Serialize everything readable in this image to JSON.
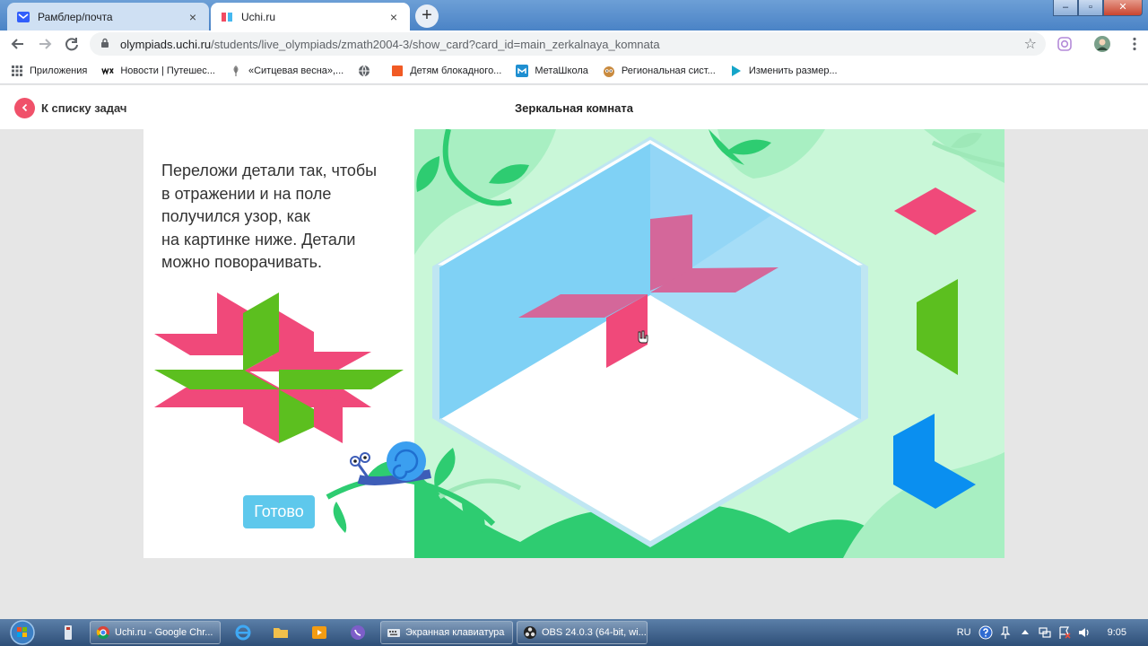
{
  "browser": {
    "tabs": [
      {
        "title": "Рамблер/почта",
        "active": false
      },
      {
        "title": "Uchi.ru",
        "active": true
      }
    ],
    "new_tab_symbol": "+",
    "close_symbol": "×",
    "window_controls": {
      "minimize": "–",
      "maximize": "▫",
      "close": "✕"
    },
    "url": {
      "host": "olympiads.uchi.ru",
      "path": "/students/live_olympiads/zmath2004-3/show_card?card_id=main_zerkalnaya_komnata"
    },
    "bookmarks": [
      {
        "label": "Приложения",
        "icon": "apps-grid-icon"
      },
      {
        "label": "Новости | Путешес...",
        "icon": "wix-icon"
      },
      {
        "label": "«Ситцевая весна»,...",
        "icon": "feather-icon"
      },
      {
        "label": "",
        "icon": "globe-icon"
      },
      {
        "label": "Детям блокадного...",
        "icon": "orange-square-icon"
      },
      {
        "label": "МетаШкола",
        "icon": "metaschool-icon"
      },
      {
        "label": "Региональная сист...",
        "icon": "owl-icon"
      },
      {
        "label": "Изменить размер...",
        "icon": "play-triangle-icon"
      }
    ]
  },
  "page": {
    "back_label": "К списку задач",
    "title": "Зеркальная комната"
  },
  "task": {
    "instruction_lines": [
      "Переложи детали так, чтобы",
      "в отражении и на поле",
      "получился узор, как",
      "на картинке ниже. Детали",
      "можно поворачивать."
    ],
    "done_label": "Готово"
  },
  "colors": {
    "pink": "#f0497a",
    "green": "#5cbf1f",
    "blue": "#0a8ff0",
    "mirror_blue": "#7fd1f5",
    "back_button": "#f0516a",
    "done_button": "#5ec8ec",
    "leaf_green": "#2ecc71"
  },
  "taskbar": {
    "tasks": [
      {
        "label": "Uchi.ru - Google Chr..."
      },
      {
        "label": "Экранная клавиатура"
      },
      {
        "label": "OBS 24.0.3 (64-bit, wi..."
      }
    ],
    "language": "RU",
    "clock": "9:05"
  }
}
